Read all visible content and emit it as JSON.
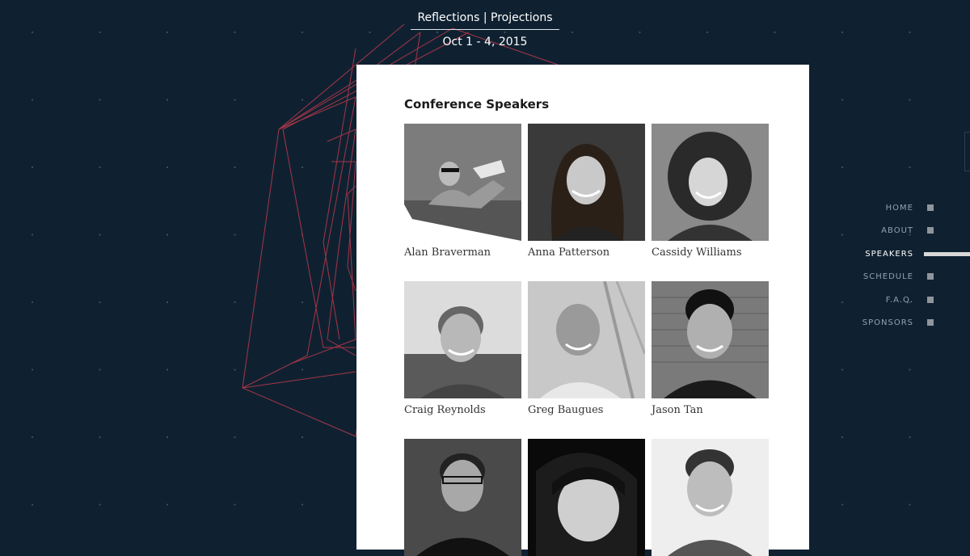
{
  "header": {
    "title": "Reflections | Projections",
    "dates": "Oct 1 - 4, 2015"
  },
  "section": {
    "title": "Conference Speakers"
  },
  "speakers": [
    {
      "name": "Alan Braverman"
    },
    {
      "name": "Anna Patterson"
    },
    {
      "name": "Cassidy Williams"
    },
    {
      "name": "Craig Reynolds"
    },
    {
      "name": "Greg Baugues"
    },
    {
      "name": "Jason Tan"
    },
    {
      "name": ""
    },
    {
      "name": ""
    },
    {
      "name": ""
    }
  ],
  "nav": {
    "items": [
      {
        "label": "HOME"
      },
      {
        "label": "ABOUT"
      },
      {
        "label": "SPEAKERS"
      },
      {
        "label": "SCHEDULE"
      },
      {
        "label": "F.A.Q."
      },
      {
        "label": "SPONSORS"
      }
    ],
    "active": "SPEAKERS"
  },
  "colors": {
    "background": "#0f2131",
    "accent_lines": "#c0394b",
    "card": "#ffffff"
  }
}
